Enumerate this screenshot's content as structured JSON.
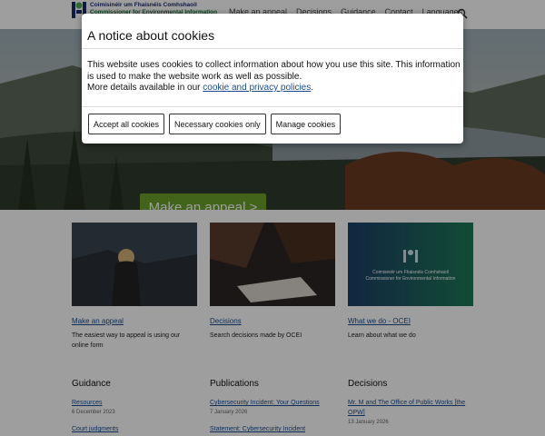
{
  "header": {
    "logo_line1": "Coimisinéir um Fhaisnéis Comhshaoil",
    "logo_line2": "Commissioner for Environmental Information",
    "nav": [
      "Make an appeal",
      "Decisions",
      "Guidance",
      "Contact",
      "Languages"
    ]
  },
  "hero": {
    "cta_label": "Make an appeal >"
  },
  "cards": [
    {
      "link": "Make an appeal",
      "desc": "The easiest way to appeal is using our online form"
    },
    {
      "link": "Decisions",
      "desc": "Search decisions made by OCEI"
    },
    {
      "link": "What we do - OCEI",
      "desc": "Learn about what we do",
      "img_line1": "Coimisinéir um Fhaisnéis Comhshaoil",
      "img_line2": "Commissioner for Environmental Information"
    }
  ],
  "lists": [
    {
      "title": "Guidance",
      "items": [
        {
          "link": "Resources",
          "date": "6 December 2023"
        },
        {
          "link": "Court judgments",
          "date": ""
        }
      ]
    },
    {
      "title": "Publications",
      "items": [
        {
          "link": "Cybersecurity Incident: Your Questions",
          "date": "7 January 2026"
        },
        {
          "link": "Statement: Cybersecurity Incident",
          "date": ""
        }
      ]
    },
    {
      "title": "Decisions",
      "items": [
        {
          "link": "Mr. M and The Office of Public Works [the OPW]",
          "date": "13 January 2026"
        }
      ]
    }
  ],
  "cookie_modal": {
    "title": "A notice about cookies",
    "body_1": "This website uses cookies to collect information about how you use this site. This information is used to make the website work as well as possible.",
    "body_2_prefix": "More details available in our ",
    "body_2_link": "cookie and privacy policies",
    "body_2_suffix": ".",
    "buttons": {
      "accept_all": "Accept all cookies",
      "necessary": "Necessary cookies only",
      "manage": "Manage cookies"
    }
  },
  "colors": {
    "brand_blue": "#1f2a6b",
    "brand_green": "#6aa12a",
    "link": "#1a4d8f"
  }
}
